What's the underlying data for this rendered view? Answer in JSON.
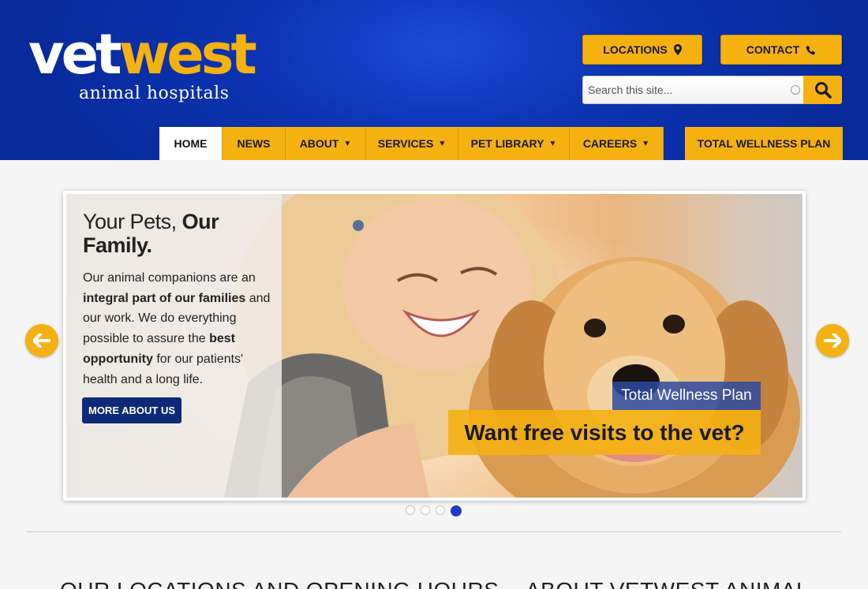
{
  "brand": {
    "name_part1": "vet",
    "name_part2": "west",
    "tagline": "animal hospitals",
    "colors": {
      "primary_blue": "#0c33b3",
      "accent_gold": "#f4b110",
      "cta_navy": "#0d2a78"
    }
  },
  "header": {
    "locations_label": "LOCATIONS",
    "locations_icon": "map-marker-icon",
    "contact_label": "CONTACT",
    "contact_icon": "phone-icon",
    "search": {
      "placeholder": "Search this site...",
      "value": "",
      "button_icon": "search-icon"
    }
  },
  "nav": {
    "items": [
      {
        "label": "HOME",
        "active": true,
        "has_dropdown": false
      },
      {
        "label": "NEWS",
        "active": false,
        "has_dropdown": false
      },
      {
        "label": "ABOUT",
        "active": false,
        "has_dropdown": true
      },
      {
        "label": "SERVICES",
        "active": false,
        "has_dropdown": true
      },
      {
        "label": "PET LIBRARY",
        "active": false,
        "has_dropdown": true
      },
      {
        "label": "CAREERS",
        "active": false,
        "has_dropdown": true
      }
    ],
    "wellness_label": "TOTAL WELLNESS PLAN",
    "caret": "▼"
  },
  "hero": {
    "heading_light": "Your Pets, ",
    "heading_bold_1": "Our",
    "heading_bold_2": "Family.",
    "body": {
      "p1": "Our animal companions are an ",
      "b1": "integral part of our families",
      "p2": " and our work. We do everything possible to assure the ",
      "b2": "best opportunity",
      "p3": " for our patients' health and a long life."
    },
    "cta_label": "MORE ABOUT US",
    "promo_label": "Total Wellness Plan",
    "promo_text": "Want free visits to the vet?"
  },
  "carousel": {
    "slide_count": 4,
    "active_index": 4,
    "prev_icon": "arrow-left-icon",
    "next_icon": "arrow-right-icon"
  },
  "sections": {
    "locations_title": "OUR LOCATIONS AND OPENING HOURS",
    "about_title": "ABOUT VETWEST ANIMAL"
  }
}
